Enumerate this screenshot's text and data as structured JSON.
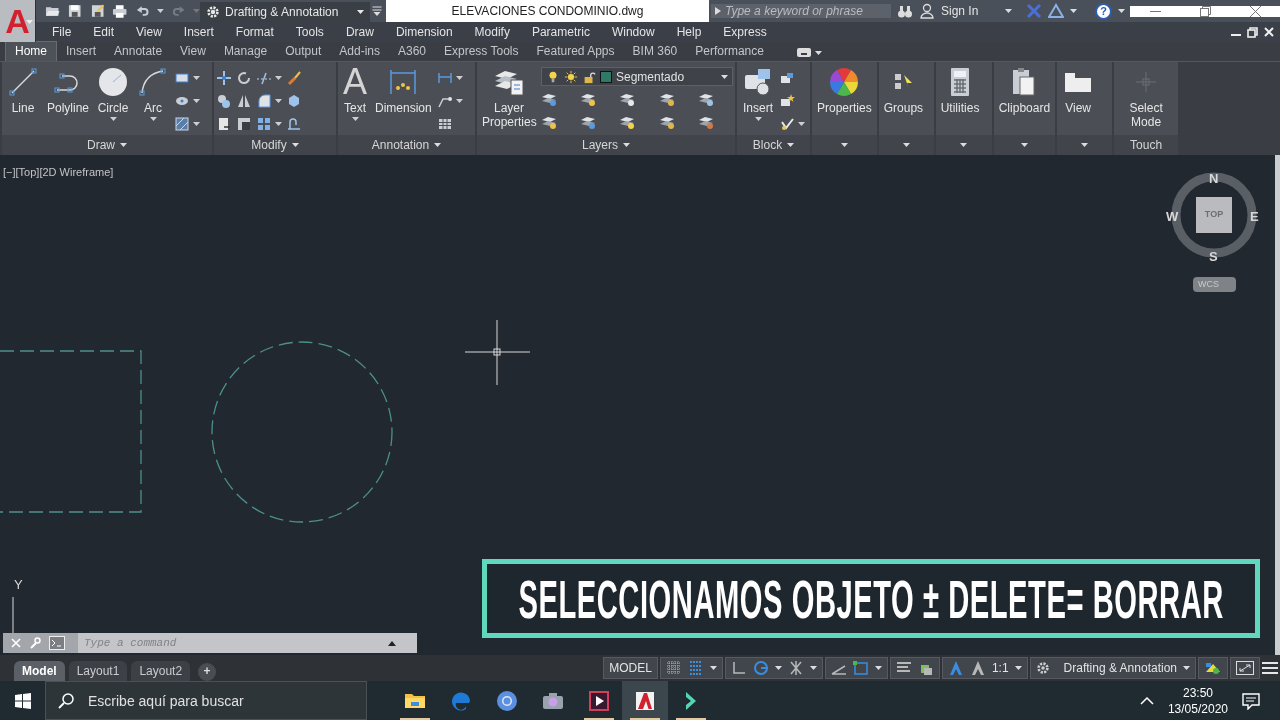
{
  "app_button": {
    "glyph": "A"
  },
  "quick_access": [
    {
      "kind": "open",
      "disabled": false
    },
    {
      "kind": "save",
      "disabled": false
    },
    {
      "kind": "saveas",
      "disabled": false
    },
    {
      "kind": "print",
      "disabled": false
    },
    {
      "kind": "undo",
      "disabled": false
    },
    {
      "kind": "redo",
      "disabled": true
    }
  ],
  "workspace": "Drafting & Annotation",
  "document_title": "ELEVACIONES CONDOMINIO.dwg",
  "search": {
    "placeholder": "Type a keyword or phrase"
  },
  "sign_in": "Sign In",
  "help": "?",
  "menu_bar": [
    "File",
    "Edit",
    "View",
    "Insert",
    "Format",
    "Tools",
    "Draw",
    "Dimension",
    "Modify",
    "Parametric",
    "Window",
    "Help",
    "Express"
  ],
  "ribbon_tabs": [
    {
      "label": "Home",
      "selected": true
    },
    {
      "label": "Insert",
      "selected": false
    },
    {
      "label": "Annotate",
      "selected": false
    },
    {
      "label": "View",
      "selected": false
    },
    {
      "label": "Manage",
      "selected": false
    },
    {
      "label": "Output",
      "selected": false
    },
    {
      "label": "Add-ins",
      "selected": false
    },
    {
      "label": "A360",
      "selected": false
    },
    {
      "label": "Express Tools",
      "selected": false
    },
    {
      "label": "Featured Apps",
      "selected": false
    },
    {
      "label": "BIM 360",
      "selected": false
    },
    {
      "label": "Performance",
      "selected": false
    }
  ],
  "ribbon_panels": [
    {
      "kind": "draw",
      "title": "Draw",
      "menu": true,
      "tools": [
        {
          "label": "Line",
          "dropdown": false
        },
        {
          "label": "Polyline",
          "dropdown": false
        },
        {
          "label": "Circle",
          "dropdown": true
        },
        {
          "label": "Arc",
          "dropdown": true
        }
      ]
    },
    {
      "kind": "modify",
      "title": "Modify",
      "menu": true
    },
    {
      "kind": "annotation",
      "title": "Annotation",
      "menu": true,
      "tools": [
        {
          "label": "Text",
          "glyph": "A",
          "dropdown": true
        },
        {
          "label": "Dimension",
          "dropdown": false
        }
      ]
    },
    {
      "kind": "layers",
      "title": "Layers",
      "menu": true,
      "tools": [
        {
          "label": "Layer Properties",
          "dropdown": false
        }
      ],
      "layer": {
        "name": "Segmentado",
        "color": "#2f7a67"
      }
    },
    {
      "kind": "block",
      "title": "Block",
      "menu": true,
      "tools": [
        {
          "label": "Insert",
          "dropdown": true
        }
      ]
    },
    {
      "kind": "properties",
      "menu": true,
      "tools": [
        {
          "label": "Properties",
          "dropdown": false
        }
      ]
    },
    {
      "kind": "groups",
      "menu": true,
      "tools": [
        {
          "label": "Groups",
          "dropdown": false
        }
      ]
    },
    {
      "kind": "utilities",
      "menu": true,
      "tools": [
        {
          "label": "Utilities",
          "dropdown": false
        }
      ]
    },
    {
      "kind": "clipboard",
      "menu": true,
      "tools": [
        {
          "label": "Clipboard",
          "dropdown": false
        }
      ]
    },
    {
      "kind": "view",
      "menu": true,
      "tools": [
        {
          "label": "View",
          "dropdown": false
        }
      ]
    },
    {
      "kind": "touch",
      "title": "Touch",
      "menu": false,
      "tools": [
        {
          "label": "Select Mode",
          "dropdown": false
        }
      ]
    }
  ],
  "viewport_controls": [
    "[−]",
    "[Top]",
    "[2D Wireframe]"
  ],
  "viewcube": {
    "north": "N",
    "east": "E",
    "south": "S",
    "west": "W",
    "face": "TOP",
    "ucs_menu": "WCS"
  },
  "ucs_axis": "Y",
  "command_line": {
    "placeholder": "Type a command"
  },
  "caption": "SELECCIONAMOS OBJETO ± DELETE= BORRAR",
  "layout_tabs": [
    {
      "label": "Model",
      "selected": true
    },
    {
      "label": "Layout1",
      "selected": false
    },
    {
      "label": "Layout2",
      "selected": false
    }
  ],
  "add_layout": "+",
  "status_bar": {
    "space": "MODEL",
    "toggles": [
      {
        "kind": "grid",
        "on": false
      },
      {
        "kind": "snap",
        "on": true
      },
      {
        "kind": "ortho",
        "on": false
      },
      {
        "kind": "polar",
        "on": true
      },
      {
        "kind": "isodraft",
        "on": false
      },
      {
        "kind": "tracking",
        "on": false
      },
      {
        "kind": "osnap",
        "on": true
      },
      {
        "kind": "lineweight",
        "on": false
      },
      {
        "kind": "selection",
        "on": false
      },
      {
        "kind": "annovisibility",
        "on": true
      },
      {
        "kind": "autoscale",
        "on": false
      }
    ],
    "scale": "1:1",
    "workspace": "Drafting & Annotation"
  },
  "taskbar": {
    "search": {
      "placeholder": "Escribe aquí para buscar"
    },
    "apps": [
      {
        "kind": "files",
        "active": false,
        "running": true
      },
      {
        "kind": "edge",
        "active": false,
        "running": false
      },
      {
        "kind": "chrome",
        "active": false,
        "running": false
      },
      {
        "kind": "camera",
        "active": false,
        "running": false
      },
      {
        "kind": "video",
        "active": false,
        "running": true
      },
      {
        "kind": "autocad",
        "active": true,
        "running": true
      },
      {
        "kind": "filmora",
        "active": false,
        "running": true
      }
    ],
    "time": "23:50",
    "date": "13/05/2020"
  }
}
